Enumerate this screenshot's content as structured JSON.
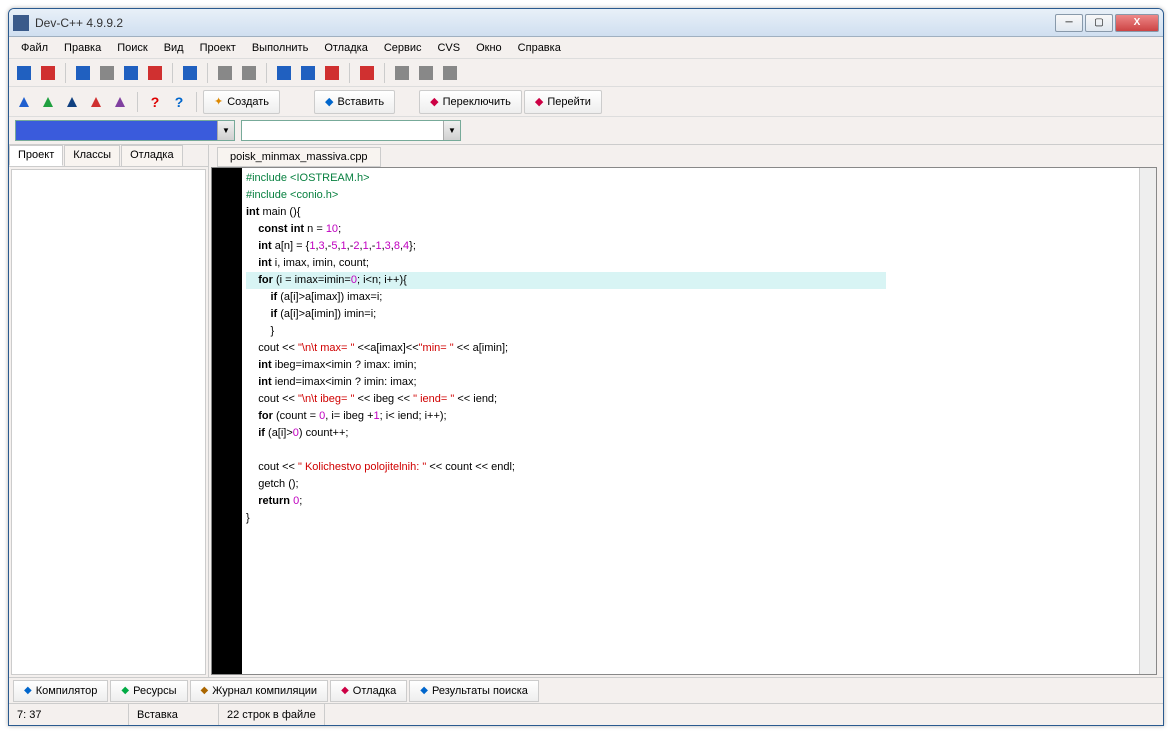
{
  "window": {
    "title": "Dev-C++ 4.9.9.2"
  },
  "menu": [
    "Файл",
    "Правка",
    "Поиск",
    "Вид",
    "Проект",
    "Выполнить",
    "Отладка",
    "Сервис",
    "CVS",
    "Окно",
    "Справка"
  ],
  "toolbar2_buttons": [
    {
      "label": "Создать",
      "icon": "star"
    },
    {
      "label": "Вставить",
      "icon": "diamond"
    },
    {
      "label": "Переключить",
      "icon": "diamond"
    },
    {
      "label": "Перейти",
      "icon": "diamond"
    }
  ],
  "left_tabs": [
    "Проект",
    "Классы",
    "Отладка"
  ],
  "file_tab": "poisk_minmax_massiva.cpp",
  "code_lines": [
    {
      "t": "pre",
      "c": "#include <IOSTREAM.h>"
    },
    {
      "t": "pre",
      "c": "#include <conio.h>"
    },
    {
      "t": "raw",
      "c": "<span class='kw'>int</span> main (){"
    },
    {
      "t": "raw",
      "c": "    <span class='kw'>const</span> <span class='kw'>int</span> n = <span class='num'>10</span>;"
    },
    {
      "t": "raw",
      "c": "    <span class='kw'>int</span> a[n] = {<span class='num'>1</span>,<span class='num'>3</span>,-<span class='num'>5</span>,<span class='num'>1</span>,-<span class='num'>2</span>,<span class='num'>1</span>,-<span class='num'>1</span>,<span class='num'>3</span>,<span class='num'>8</span>,<span class='num'>4</span>};"
    },
    {
      "t": "raw",
      "c": "    <span class='kw'>int</span> i, imax, imin, count;"
    },
    {
      "t": "raw",
      "hl": true,
      "c": "    <span class='kw'>for</span> (i = imax=imin=<span class='num'>0</span>; i&lt;n; i++){"
    },
    {
      "t": "raw",
      "c": "        <span class='kw'>if</span> (a[i]&gt;a[imax]) imax=i;"
    },
    {
      "t": "raw",
      "c": "        <span class='kw'>if</span> (a[i]&gt;a[imin]) imin=i;"
    },
    {
      "t": "raw",
      "c": "        }"
    },
    {
      "t": "raw",
      "c": "    cout &lt;&lt; <span class='str'>\"\\n\\t max= \"</span> &lt;&lt;a[imax]&lt;&lt;<span class='str'>\"min= \"</span> &lt;&lt; a[imin];"
    },
    {
      "t": "raw",
      "c": "    <span class='kw'>int</span> ibeg=imax&lt;imin ? imax: imin;"
    },
    {
      "t": "raw",
      "c": "    <span class='kw'>int</span> iend=imax&lt;imin ? imin: imax;"
    },
    {
      "t": "raw",
      "c": "    cout &lt;&lt; <span class='str'>\"\\n\\t ibeg= \"</span> &lt;&lt; ibeg &lt;&lt; <span class='str'>\" iend= \"</span> &lt;&lt; iend;"
    },
    {
      "t": "raw",
      "c": "    <span class='kw'>for</span> (count = <span class='num'>0</span>, i= ibeg +<span class='num'>1</span>; i&lt; iend; i++);"
    },
    {
      "t": "raw",
      "c": "    <span class='kw'>if</span> (a[i]&gt;<span class='num'>0</span>) count++;"
    },
    {
      "t": "raw",
      "c": ""
    },
    {
      "t": "raw",
      "c": "    cout &lt;&lt; <span class='str'>\" Kolichestvo polojitelnih: \"</span> &lt;&lt; count &lt;&lt; endl;"
    },
    {
      "t": "raw",
      "c": "    getch ();"
    },
    {
      "t": "raw",
      "c": "    <span class='kw'>return</span> <span class='num'>0</span>;"
    },
    {
      "t": "raw",
      "c": "}"
    }
  ],
  "bottom_tabs": [
    "Компилятор",
    "Ресурсы",
    "Журнал компиляции",
    "Отладка",
    "Результаты поиска"
  ],
  "status": {
    "pos": "7: 37",
    "mode": "Вставка",
    "info": "22 строк в файле"
  }
}
